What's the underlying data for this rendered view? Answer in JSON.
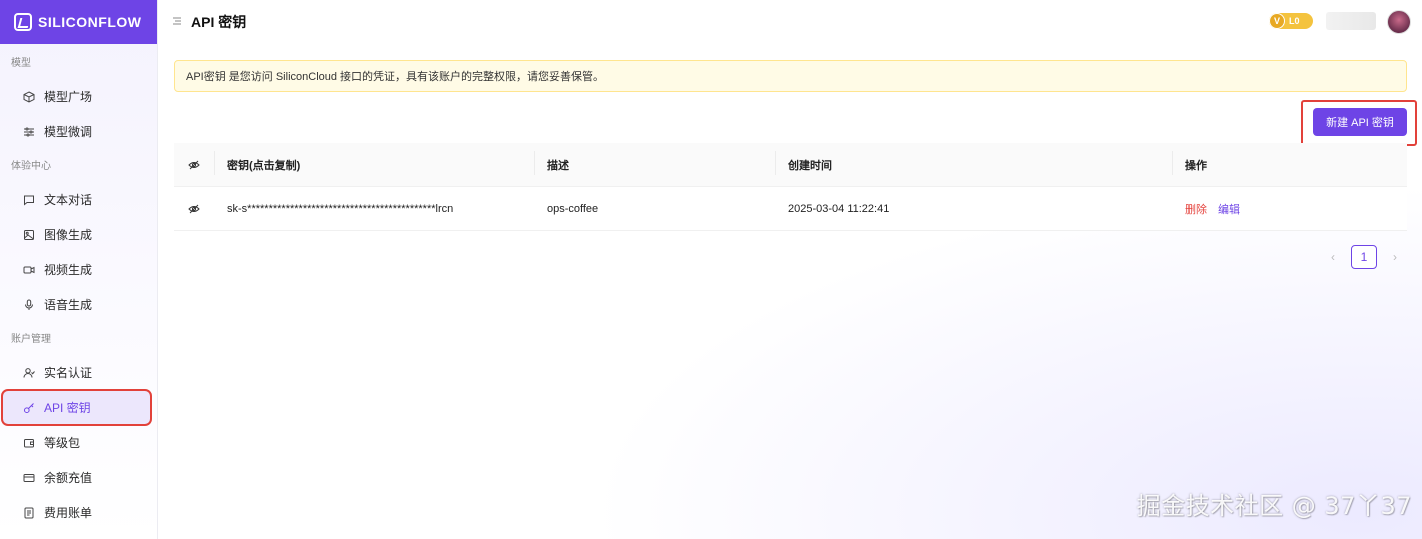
{
  "brand": {
    "name": "SILICONFLOW"
  },
  "sidebar": {
    "sections": [
      {
        "title": "模型",
        "items": [
          {
            "label": "模型广场",
            "icon": "cube-icon"
          },
          {
            "label": "模型微调",
            "icon": "sliders-icon"
          }
        ]
      },
      {
        "title": "体验中心",
        "items": [
          {
            "label": "文本对话",
            "icon": "chat-icon"
          },
          {
            "label": "图像生成",
            "icon": "image-icon"
          },
          {
            "label": "视频生成",
            "icon": "video-icon"
          },
          {
            "label": "语音生成",
            "icon": "mic-icon"
          }
        ]
      },
      {
        "title": "账户管理",
        "items": [
          {
            "label": "实名认证",
            "icon": "user-check-icon"
          },
          {
            "label": "API 密钥",
            "icon": "key-icon",
            "active": true
          },
          {
            "label": "等级包",
            "icon": "wallet-icon"
          },
          {
            "label": "余额充值",
            "icon": "credit-card-icon"
          },
          {
            "label": "费用账单",
            "icon": "receipt-icon"
          }
        ]
      }
    ]
  },
  "header": {
    "title": "API 密钥",
    "level": "L0"
  },
  "notice": "API密钥 是您访问 SiliconCloud 接口的凭证，具有该账户的完整权限，请您妥善保管。",
  "toolbar": {
    "new_key_label": "新建 API 密钥"
  },
  "table": {
    "columns": [
      "密钥(点击复制)",
      "描述",
      "创建时间",
      "操作"
    ],
    "rows": [
      {
        "key": "sk-s********************************************lrcn",
        "desc": "ops-coffee",
        "created": "2025-03-04 11:22:41",
        "ops": [
          "删除",
          "编辑"
        ]
      }
    ]
  },
  "pagination": {
    "current": "1"
  },
  "watermark": "掘金技术社区 @ 37丫37",
  "colors": {
    "accent": "#6e44e6",
    "danger": "#e5423c",
    "highlight": "#e2413a"
  }
}
